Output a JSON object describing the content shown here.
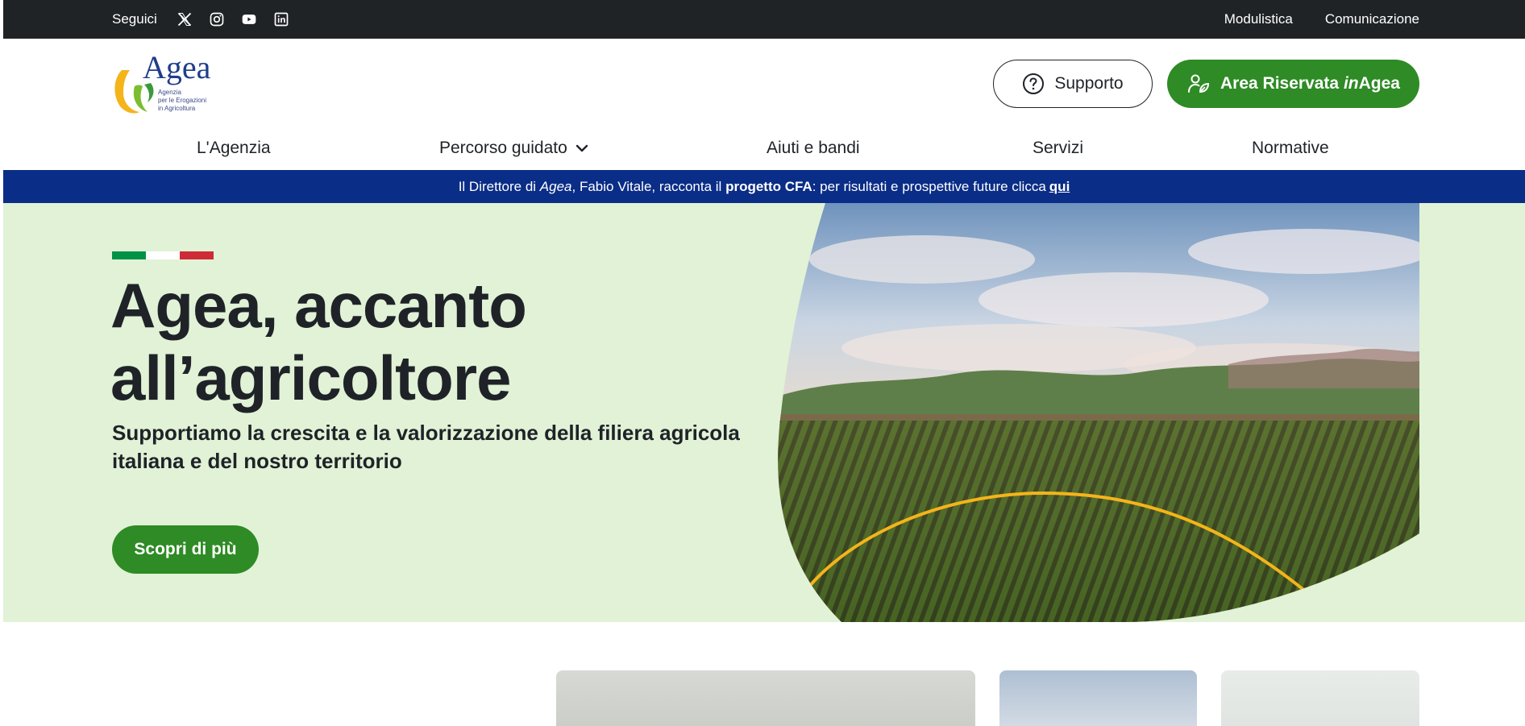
{
  "topbar": {
    "follow_label": "Seguici",
    "social": [
      {
        "icon": "x-icon"
      },
      {
        "icon": "instagram-icon"
      },
      {
        "icon": "youtube-icon"
      },
      {
        "icon": "linkedin-icon"
      }
    ],
    "links": [
      "Modulistica",
      "Comunicazione"
    ]
  },
  "header": {
    "logo": {
      "wordmark": "Agea",
      "tagline_1": "Agenzia",
      "tagline_2": "per le Erogazioni",
      "tagline_3": "in Agricoltura"
    },
    "support_label": "Supporto",
    "area_label_prefix": "Area Riservata ",
    "area_label_italic": "in",
    "area_label_suffix": "Agea"
  },
  "nav": {
    "items": [
      "L'Agenzia",
      "Percorso guidato",
      "Aiuti e bandi",
      "Servizi",
      "Normative"
    ]
  },
  "banner": {
    "text_1": "Il Direttore di ",
    "text_italic": "Agea",
    "text_2": ", Fabio Vitale, racconta il ",
    "text_bold": "progetto CFA",
    "text_3": ": per risultati e prospettive future clicca",
    "link": "qui "
  },
  "hero": {
    "title_line_1": "Agea, accanto",
    "title_line_2": "all’agricoltore",
    "subtitle": "Supportiamo la crescita e la valorizzazione della filiera agricola italiana e del nostro territorio",
    "cta": "Scopri di più"
  },
  "colors": {
    "topbar_bg": "#202326",
    "brand_green": "#2e8b25",
    "banner_blue": "#0a2d87",
    "hero_bg": "#e1f2d6",
    "flag_green": "#009246",
    "flag_white": "#ffffff",
    "flag_red": "#ce2b37",
    "accent_yellow": "#f4b41a"
  }
}
